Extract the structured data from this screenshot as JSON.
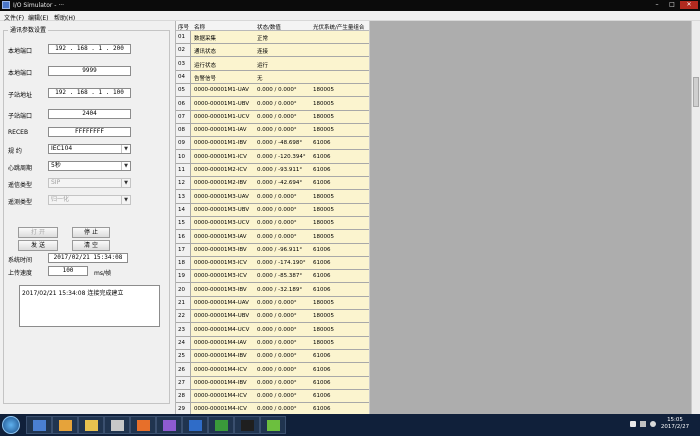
{
  "window": {
    "title": "I/O Simulator - ···"
  },
  "menu": [
    "文件(F)",
    "编辑(E)",
    "帮助(H)"
  ],
  "left_panel": {
    "group_title": "通讯参数设置",
    "fields": [
      {
        "label": "本地端口",
        "value": "192 . 168 . 1 . 200"
      },
      {
        "label": "本地端口",
        "value": "9999"
      },
      {
        "label": "子站地址",
        "value": "192 . 168 . 1 . 100"
      },
      {
        "label": "子站端口",
        "value": "2404"
      },
      {
        "label": "RECEB",
        "value": "FFFFFFFF"
      }
    ],
    "combos": [
      {
        "label": "规  约",
        "value": "IEC104"
      },
      {
        "label": "心跳周期",
        "value": "5秒"
      },
      {
        "label": "遥信类型",
        "value": "SIP"
      },
      {
        "label": "遥测类型",
        "value": "归一化"
      }
    ],
    "buttons": {
      "start": "打 开",
      "stop": "停 止",
      "send": "发 送",
      "clear": "清 空"
    },
    "time_label": "系统时间",
    "time_value": "2017/02/21  15:34:08",
    "rate_label": "上传速度",
    "rate_value": "100",
    "rate_unit": "ms/帧",
    "log_text": "2017/02/21  15:34:08  连接完成建立"
  },
  "table": {
    "headers": [
      "序号",
      "名称",
      "状态/数值",
      "光伏系统/产生量组合"
    ],
    "rows": [
      [
        "01",
        "数据采集",
        "正常",
        ""
      ],
      [
        "02",
        "通讯状态",
        "连接",
        ""
      ],
      [
        "03",
        "运行状态",
        "运行",
        ""
      ],
      [
        "04",
        "告警信号",
        "无",
        ""
      ],
      [
        "05",
        "0000-00001M1-UAV",
        "0.000 / 0.000°",
        "180005"
      ],
      [
        "06",
        "0000-00001M1-UBV",
        "0.000 / 0.000°",
        "180005"
      ],
      [
        "07",
        "0000-00001M1-UCV",
        "0.000 / 0.000°",
        "180005"
      ],
      [
        "08",
        "0000-00001M1-IAV",
        "0.000 / 0.000°",
        "180005"
      ],
      [
        "09",
        "0000-00001M1-IBV",
        "0.000 / -48.698°",
        "61006"
      ],
      [
        "10",
        "0000-00001M1-ICV",
        "0.000 / -120.394°",
        "61006"
      ],
      [
        "11",
        "0000-00001M2-ICV",
        "0.000 / -93.911°",
        "61006"
      ],
      [
        "12",
        "0000-00001M2-IBV",
        "0.000 / -42.694°",
        "61006"
      ],
      [
        "13",
        "0000-00001M3-UAV",
        "0.000 / 0.000°",
        "180005"
      ],
      [
        "14",
        "0000-00001M3-UBV",
        "0.000 / 0.000°",
        "180005"
      ],
      [
        "15",
        "0000-00001M3-UCV",
        "0.000 / 0.000°",
        "180005"
      ],
      [
        "16",
        "0000-00001M3-IAV",
        "0.000 / 0.000°",
        "180005"
      ],
      [
        "17",
        "0000-00001M3-IBV",
        "0.000 / -96.911°",
        "61006"
      ],
      [
        "18",
        "0000-00001M3-ICV",
        "0.000 / -174.190°",
        "61006"
      ],
      [
        "19",
        "0000-00001M3-ICV",
        "0.000 / -85.387°",
        "61006"
      ],
      [
        "20",
        "0000-00001M3-IBV",
        "0.000 / -32.189°",
        "61006"
      ],
      [
        "21",
        "0000-00001M4-UAV",
        "0.000 / 0.000°",
        "180005"
      ],
      [
        "22",
        "0000-00001M4-UBV",
        "0.000 / 0.000°",
        "180005"
      ],
      [
        "23",
        "0000-00001M4-UCV",
        "0.000 / 0.000°",
        "180005"
      ],
      [
        "24",
        "0000-00001M4-IAV",
        "0.000 / 0.000°",
        "180005"
      ],
      [
        "25",
        "0000-00001M4-IBV",
        "0.000 / 0.000°",
        "61006"
      ],
      [
        "26",
        "0000-00001M4-ICV",
        "0.000 / 0.000°",
        "61006"
      ],
      [
        "27",
        "0000-00001M4-IBV",
        "0.000 / 0.000°",
        "61006"
      ],
      [
        "28",
        "0000-00001M4-ICV",
        "0.000 / 0.000°",
        "61006"
      ],
      [
        "29",
        "0000-00001M4-ICV",
        "0.000 / 0.000°",
        "61006"
      ]
    ]
  },
  "taskbar": {
    "apps": [
      "explorer-icon",
      "media-player-icon",
      "folder-icon",
      "documents-icon",
      "firefox-icon",
      "app-icon",
      "word-icon",
      "excel-icon",
      "terminal-icon",
      "simulator-icon"
    ],
    "clock_time": "15:05",
    "clock_date": "2017/2/27"
  }
}
